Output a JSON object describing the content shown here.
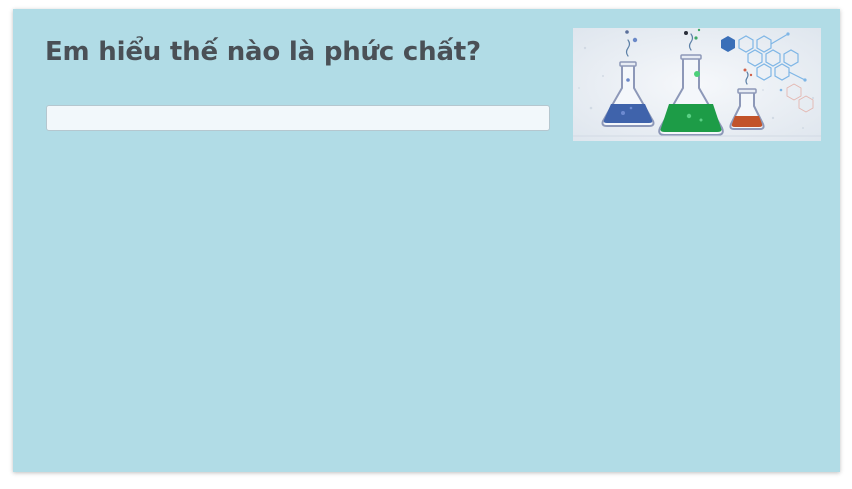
{
  "question": {
    "text": "Em hiểu thế nào là phức chất?"
  },
  "answer": {
    "value": "",
    "placeholder": ""
  },
  "illustration": {
    "icons": [
      "flask-blue-icon",
      "flask-green-icon",
      "flask-orange-icon",
      "hexagon-molecule-icon"
    ],
    "colors": {
      "blue_liquid": "#3f63ab",
      "green_liquid": "#1d9c47",
      "orange_liquid": "#c2532a",
      "background": "#e9eef4"
    }
  }
}
